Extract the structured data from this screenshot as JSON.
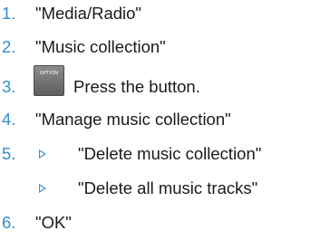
{
  "accent_color": "#2f8fd0",
  "steps": [
    {
      "number": "1.",
      "text": "\"Media/Radio\""
    },
    {
      "number": "2.",
      "text": "\"Music collection\""
    },
    {
      "number": "3.",
      "button_label": "OPTION",
      "text": "Press the button."
    },
    {
      "number": "4.",
      "text": "\"Manage music collection\""
    },
    {
      "number": "5.",
      "text": "\"Delete music collection\""
    },
    {
      "text": "\"Delete all music tracks\""
    },
    {
      "number": "6.",
      "text": "\"OK\""
    }
  ]
}
